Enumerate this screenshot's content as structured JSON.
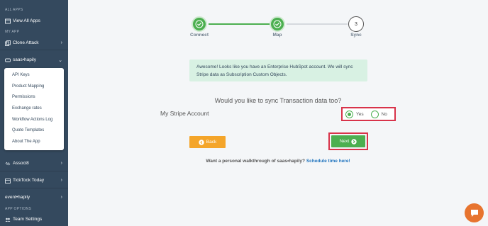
{
  "sidebar": {
    "section_all_apps": "ALL APPS",
    "view_all_apps": "View All Apps",
    "section_my_app": "MY APP",
    "clone_attack": "Clone Attack",
    "saas_hapily": "saas•hapily",
    "submenu": [
      "API Keys",
      "Product Mapping",
      "Permissions",
      "Exchange rates",
      "Workflow Actions Log",
      "Quote Templates",
      "About The App"
    ],
    "associ8": "Associ8",
    "ticktock_today": "TickTock Today",
    "event_hapily": "event•hapily",
    "section_app_options": "APP OPTIONS",
    "team_settings": "Team Settings"
  },
  "stepper": {
    "steps": [
      {
        "label": "Connect",
        "state": "done"
      },
      {
        "label": "Map",
        "state": "done"
      },
      {
        "label": "Sync",
        "state": "current",
        "number": "3"
      }
    ],
    "done_color": "#4caf50"
  },
  "alert": {
    "text": "Awesome! Looks like you have an Enterprise HubSpot account. We will sync Stripe data as Subscription Custom Objects."
  },
  "question": "Would you like to sync Transaction data too?",
  "account_label": "My Stripe Account",
  "options": {
    "yes": "Yes",
    "no": "No",
    "selected": "Yes"
  },
  "buttons": {
    "back": "Back",
    "next": "Next"
  },
  "walkthrough": {
    "text": "Want a personal walkthrough of saas•hapily?",
    "link": "Schedule time here!"
  },
  "colors": {
    "sidebar": "#34495e",
    "accent_green": "#4caf50",
    "back_orange": "#f4a52a",
    "highlight_red": "#d8334a",
    "chat_orange": "#e7742f"
  }
}
